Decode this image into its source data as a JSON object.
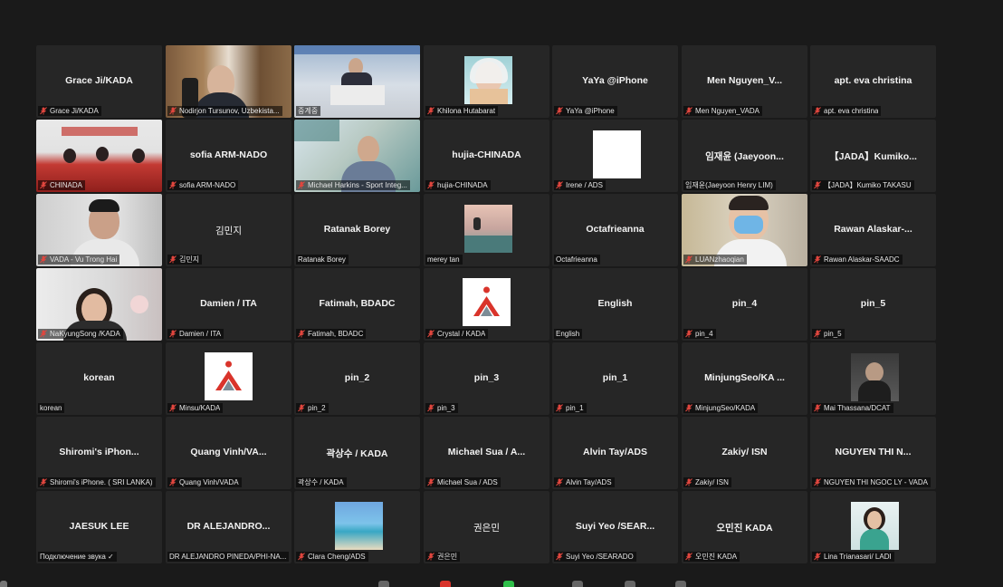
{
  "tiles": [
    {
      "name": "Grace Ji/KADA",
      "label": "Grace Ji/KADA",
      "muted": true,
      "kind": "name"
    },
    {
      "name": "",
      "label": "Nodirjon Tursunov, Uzbekista...",
      "muted": true,
      "kind": "video-office"
    },
    {
      "name": "",
      "label": "중계중",
      "muted": false,
      "kind": "video-stage",
      "active": true
    },
    {
      "name": "",
      "label": "Khilona Hutabarat",
      "muted": true,
      "kind": "pic-portrait"
    },
    {
      "name": "YaYa @iPhone",
      "label": "YaYa @iPhone",
      "muted": true,
      "kind": "name"
    },
    {
      "name": "Men  Nguyen_V...",
      "label": "Men Nguyen_VADA",
      "muted": true,
      "kind": "name"
    },
    {
      "name": "apt. eva christina",
      "label": "apt. eva christina",
      "muted": true,
      "kind": "name"
    },
    {
      "name": "",
      "label": "CHINADA",
      "muted": true,
      "kind": "video-meeting"
    },
    {
      "name": "sofia ARM-NADO",
      "label": "sofia ARM-NADO",
      "muted": true,
      "kind": "name"
    },
    {
      "name": "",
      "label": "Michael Harkins - Sport Integ...",
      "muted": true,
      "kind": "video-man"
    },
    {
      "name": "hujia-CHINADA",
      "label": "hujia-CHINADA",
      "muted": true,
      "kind": "name"
    },
    {
      "name": "",
      "label": "Irene / ADS",
      "muted": true,
      "kind": "pic-white"
    },
    {
      "name": "임재윤 (Jaeyoon...",
      "label": "임재윤(Jaeyoon Henry LIM)",
      "muted": false,
      "kind": "name"
    },
    {
      "name": "【JADA】Kumiko...",
      "label": "【JADA】Kumiko TAKASU",
      "muted": true,
      "kind": "name"
    },
    {
      "name": "",
      "label": "VADA - Vu Trong Hai",
      "muted": true,
      "kind": "video-man2"
    },
    {
      "name": "김민지",
      "label": "김민지",
      "muted": true,
      "kind": "name-light"
    },
    {
      "name": "Ratanak Borey",
      "label": "Ratanak Borey",
      "muted": false,
      "kind": "name"
    },
    {
      "name": "",
      "label": "merey tan",
      "muted": false,
      "kind": "pic-beach"
    },
    {
      "name": "Octafrieanna",
      "label": "Octafrieanna",
      "muted": false,
      "kind": "name"
    },
    {
      "name": "",
      "label": "LUANzhaoqian",
      "muted": true,
      "kind": "video-mask"
    },
    {
      "name": "Rawan  Alaskar-...",
      "label": "Rawan Alaskar-SAADC",
      "muted": true,
      "kind": "name"
    },
    {
      "name": "",
      "label": "NaKyungSong /KADA",
      "muted": true,
      "kind": "video-woman"
    },
    {
      "name": "Damien / ITA",
      "label": "Damien / ITA",
      "muted": true,
      "kind": "name"
    },
    {
      "name": "Fatimah, BDADC",
      "label": "Fatimah, BDADC",
      "muted": true,
      "kind": "name"
    },
    {
      "name": "",
      "label": "Crystal / KADA",
      "muted": true,
      "kind": "logo"
    },
    {
      "name": "English",
      "label": "English",
      "muted": false,
      "kind": "name"
    },
    {
      "name": "pin_4",
      "label": "pin_4",
      "muted": true,
      "kind": "name"
    },
    {
      "name": "pin_5",
      "label": "pin_5",
      "muted": true,
      "kind": "name"
    },
    {
      "name": "korean",
      "label": "korean",
      "muted": false,
      "kind": "name"
    },
    {
      "name": "",
      "label": "Minsu/KADA",
      "muted": true,
      "kind": "logo"
    },
    {
      "name": "pin_2",
      "label": "pin_2",
      "muted": true,
      "kind": "name"
    },
    {
      "name": "pin_3",
      "label": "pin_3",
      "muted": true,
      "kind": "name"
    },
    {
      "name": "pin_1",
      "label": "pin_1",
      "muted": true,
      "kind": "name"
    },
    {
      "name": "MinjungSeo/KA ...",
      "label": "MinjungSeo/KADA",
      "muted": true,
      "kind": "name"
    },
    {
      "name": "",
      "label": "Mai Thassana/DCAT",
      "muted": true,
      "kind": "pic-dark"
    },
    {
      "name": "Shiromi's  iPhon...",
      "label": "Shiromi's iPhone. ( SRI LANKA)",
      "muted": true,
      "kind": "name"
    },
    {
      "name": "Quang  Vinh/VA...",
      "label": "Quang Vinh/VADA",
      "muted": true,
      "kind": "name"
    },
    {
      "name": "곽상수 / KADA",
      "label": "곽상수 / KADA",
      "muted": false,
      "kind": "name"
    },
    {
      "name": "Michael Sua / A...",
      "label": "Michael Sua / ADS",
      "muted": true,
      "kind": "name"
    },
    {
      "name": "Alvin Tay/ADS",
      "label": "Alvin Tay/ADS",
      "muted": true,
      "kind": "name"
    },
    {
      "name": "Zakiy/ ISN",
      "label": "Zakiy/ ISN",
      "muted": true,
      "kind": "name"
    },
    {
      "name": "NGUYEN THI N...",
      "label": "NGUYEN THI NGOC LY - VADA",
      "muted": true,
      "kind": "name"
    },
    {
      "name": "JAESUK LEE",
      "label": "Подключение звука ✓",
      "muted": false,
      "kind": "name"
    },
    {
      "name": "DR ALEJANDRO...",
      "label": "DR ALEJANDRO PINEDA/PHI-NA...",
      "muted": false,
      "kind": "name"
    },
    {
      "name": "",
      "label": "Clara Cheng/ADS",
      "muted": true,
      "kind": "pic-sea"
    },
    {
      "name": "권은민",
      "label": "권은민",
      "muted": true,
      "kind": "name-light"
    },
    {
      "name": "Suyi Yeo /SEAR...",
      "label": "Suyi Yeo /SEARADO",
      "muted": true,
      "kind": "name"
    },
    {
      "name": "오민진  KADA",
      "label": "오민진 KADA",
      "muted": true,
      "kind": "name"
    },
    {
      "name": "",
      "label": "Lina Trianasari/ LADI",
      "muted": true,
      "kind": "pic-girl"
    }
  ],
  "colors": {
    "background": "#1a1a1a",
    "tile": "#262626",
    "active_border": "#c7d64f",
    "muted_icon": "#e0463e",
    "logo_red": "#d9342b"
  }
}
